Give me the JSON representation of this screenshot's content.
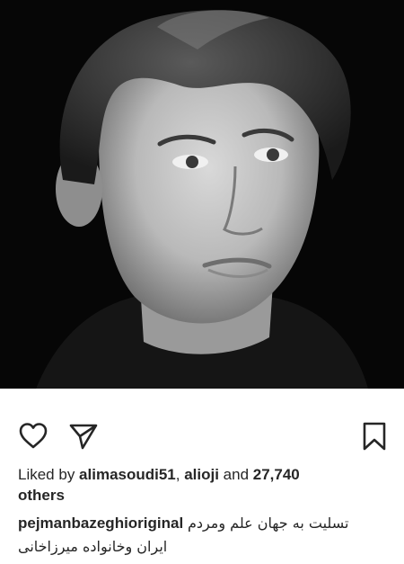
{
  "post": {
    "photo_icon": "portrait-photo",
    "actions": {
      "like_icon": "heart-outline-icon",
      "share_icon": "paper-plane-icon",
      "save_icon": "bookmark-outline-icon"
    },
    "likes": {
      "prefix": "Liked by ",
      "user1": "alimasoudi51",
      "sep": ", ",
      "user2": "alioji",
      "mid": " and ",
      "count": "27,740",
      "suffix": "others"
    },
    "caption": {
      "username": "pejmanbazeghioriginal",
      "line1": "تسلیت به جهان علم ومردم",
      "line2": "ایران وخانواده میرزاخانی"
    }
  }
}
